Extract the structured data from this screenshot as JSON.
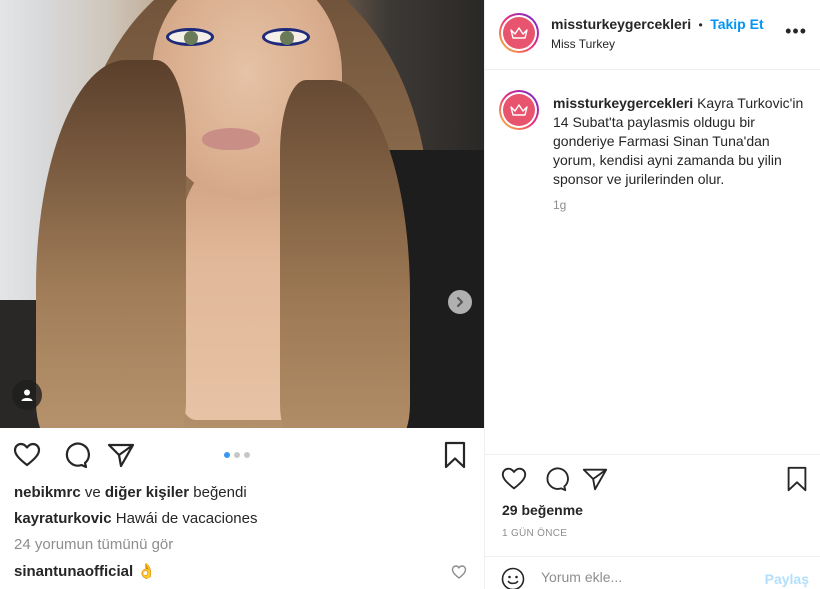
{
  "left": {
    "carousel_total": 3,
    "carousel_active": 0,
    "liked_by_user": "nebikmrc",
    "liked_by_mid": "ve",
    "liked_by_others": "diğer kişiler",
    "liked_by_suffix": "beğendi",
    "caption_user": "kayraturkovic",
    "caption_text": "Hawái de vacaciones",
    "view_comments": "24 yorumun tümünü gör",
    "comment_user": "sinantunaofficial",
    "comment_emoji": "👌"
  },
  "header": {
    "username": "missturkeygercekleri",
    "separator": "•",
    "follow_label": "Takip Et",
    "sublabel": "Miss Turkey",
    "more_label": "•••"
  },
  "caption": {
    "username": "missturkeygercekleri",
    "text": "Kayra Turkovic'in 14 Subat'ta paylasmis oldugu bir gonderiye Farmasi Sinan Tuna'dan yorum, kendisi ayni zamanda bu yilin sponsor ve jurilerinden olur.",
    "time": "1g"
  },
  "stats": {
    "likes": "29 beğenme",
    "posted": "1 GÜN ÖNCE"
  },
  "comment_box": {
    "placeholder": "Yorum ekle...",
    "share_label": "Paylaş"
  },
  "colors": {
    "link_blue": "#0095f6",
    "share_disabled": "#b2dffc",
    "avatar_pink": "#e8546e"
  }
}
